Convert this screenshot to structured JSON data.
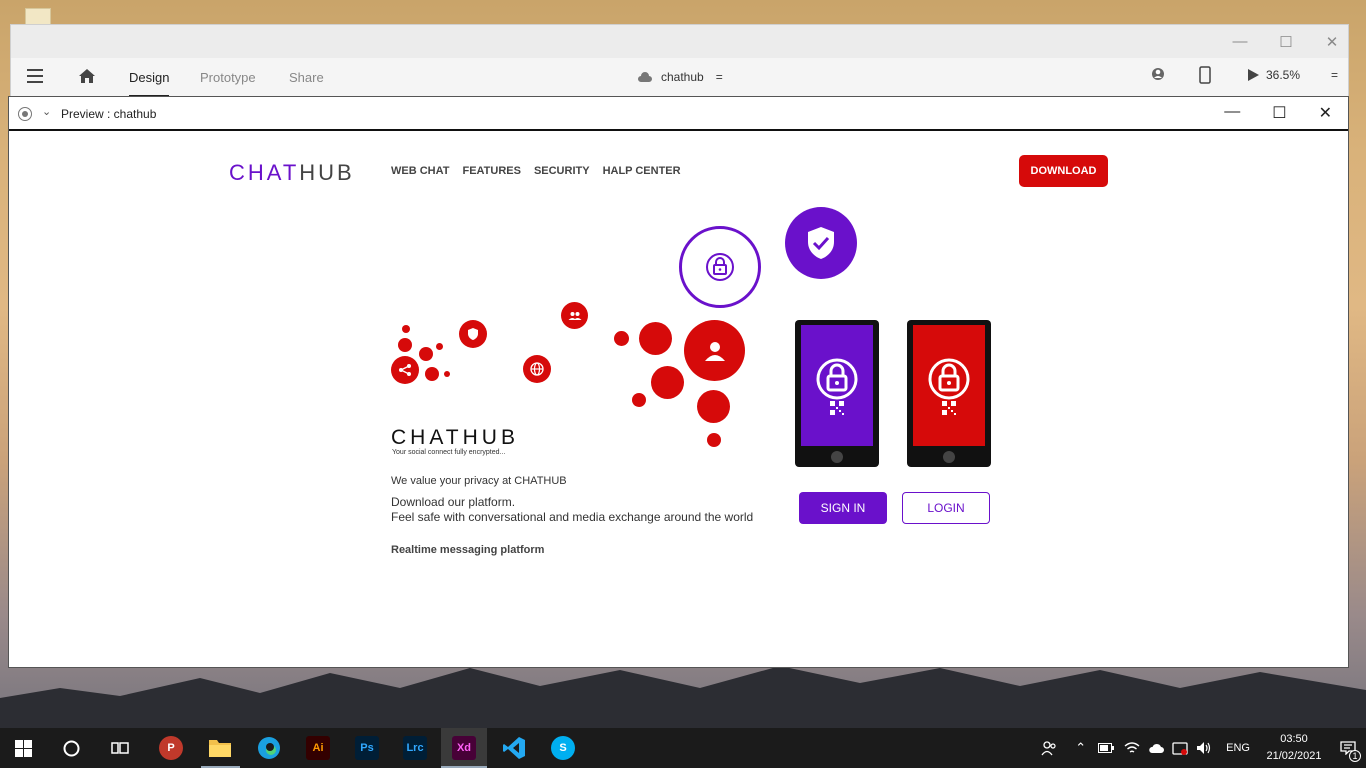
{
  "xd": {
    "tabs": [
      "Design",
      "Prototype",
      "Share"
    ],
    "doc_name": "chathub",
    "doc_menu": "=",
    "zoom": "36.5%",
    "zoom_menu": "="
  },
  "preview": {
    "title": "Preview : chathub"
  },
  "site": {
    "logo_a": "CHAT",
    "logo_b": "HUB",
    "nav": [
      "WEB CHAT",
      "FEATURES",
      "SECURITY",
      "HALP CENTER"
    ],
    "download": "DOWNLOAD",
    "title": "CHATHUB",
    "tagline": "Your social connect fully encrypted...",
    "line1": "We value your privacy at CHATHUB",
    "line2": "Download our platform.",
    "line3": "Feel safe with conversational and media exchange around the world",
    "line4": "Realtime messaging platform",
    "signin": "SIGN IN",
    "login": "LOGIN",
    "colors": {
      "primary": "#6a11cb",
      "accent": "#d60a0a"
    }
  },
  "taskbar": {
    "apps": [
      "windows-start",
      "search",
      "task-view",
      "papirus",
      "file-explorer",
      "edge",
      "illustrator",
      "photoshop",
      "lightroom-classic",
      "adobe-xd",
      "vscode",
      "skype"
    ],
    "labels": {
      "ai": "Ai",
      "ps": "Ps",
      "lrc": "Lrc",
      "xd": "Xd"
    },
    "lang": "ENG",
    "time": "03:50",
    "date": "21/02/2021",
    "notif_count": "1"
  }
}
